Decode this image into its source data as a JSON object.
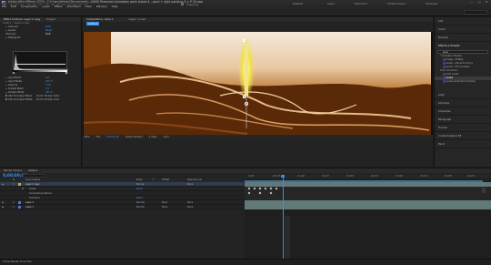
{
  "window": {
    "title": "Adobe After Effects 2022 - C:\\Users\\Admin\\Documents\\...\\0095 Perennial Animation work styled-4 - sand + light painting-3 > P 20.aep",
    "min": "—",
    "max": "□",
    "close": "✕"
  },
  "menu": [
    "File",
    "Edit",
    "Composition",
    "Layer",
    "Effect",
    "Animation",
    "View",
    "Window",
    "Help"
  ],
  "toolbar": {
    "snapping": "Snapping",
    "workspaces": [
      "Default",
      "Learn",
      "Standard",
      "Small Screen",
      "Libraries"
    ]
  },
  "effect_controls": {
    "tabs": [
      "Effect Controls: Layer 2 copy",
      "Project"
    ],
    "subtitle": "comp 1 • Layer 2 copy",
    "rows": [
      {
        "label": "Channel",
        "value": "RGB"
      },
      {
        "label": "Levels",
        "value": "Reset"
      },
      {
        "label": "Channel:",
        "value": "RGB"
      },
      {
        "label": "Histogram",
        "value": ""
      },
      {
        "label": "Input Black",
        "value": "0.0"
      },
      {
        "label": "Input White",
        "value": "255.0"
      },
      {
        "label": "Gamma",
        "value": "1.00"
      },
      {
        "label": "Output Black",
        "value": "0.0"
      },
      {
        "label": "Output White",
        "value": "255.0"
      },
      {
        "label": "Clip To Output Black",
        "value": "On for 32-bpc Color"
      },
      {
        "label": "Clip To Output White",
        "value": "On for 32-bpc Color"
      }
    ]
  },
  "composition": {
    "tabs": [
      "Composition: comp 1",
      "Layer: (none)"
    ],
    "breadcrumb": "comp 1",
    "viewer_bar": [
      "25%",
      "Full",
      "0;00;00;00",
      "Active Camera",
      "1 View",
      "+0.0"
    ]
  },
  "right_panel": {
    "items": [
      "Info",
      "Audio",
      "Preview",
      "Effects & Presets",
      "Align",
      "Libraries",
      "Character",
      "Paragraph",
      "Tracker",
      "Content-Aware Fill",
      "Paint"
    ],
    "search_placeholder": "level",
    "effects_results": [
      "* Animation Presets",
      "Image - Utilities",
      "Levels - Adjust All Colors",
      "Levels - Film Contrast",
      "Color Correction",
      "Auto Levels",
      "Levels",
      "Levels (Individual Controls)"
    ]
  },
  "timeline": {
    "tab": "comp 1",
    "render_queue": "Render Queue",
    "timecode": "0;00;00;01",
    "columns": [
      "#",
      "Source Name",
      "Mode",
      "T",
      "TrkMat",
      "Parent & Link"
    ],
    "layers": [
      {
        "num": "1",
        "name": "Layer 2 copy",
        "mode": "Normal",
        "trkmat": "",
        "parent": "None",
        "color": "#c9a24a"
      },
      {
        "num": "",
        "name": "Levels",
        "mode": "Reset",
        "trkmat": "",
        "parent": "",
        "color": "#555"
      },
      {
        "num": "",
        "name": "Compositing Options",
        "mode": "",
        "trkmat": "",
        "parent": "",
        "color": "#555"
      },
      {
        "num": "",
        "name": "Transform",
        "mode": "Reset",
        "trkmat": "",
        "parent": "",
        "color": "#555"
      },
      {
        "num": "2",
        "name": "Layer 2",
        "mode": "Normal",
        "trkmat": "None",
        "parent": "None",
        "color": "#4a7bc9"
      },
      {
        "num": "3",
        "name": "Layer 1",
        "mode": "Normal",
        "trkmat": "None",
        "parent": "None",
        "color": "#4a7bc9"
      }
    ],
    "ruler": [
      "0:00f",
      "00:15f",
      "01:00f",
      "01:15f",
      "02:00f",
      "02:15f",
      "03:00f",
      "03:15f",
      "04:00f",
      "04:15f"
    ]
  },
  "status": {
    "render_time": "Frame Render Time 0ms"
  }
}
